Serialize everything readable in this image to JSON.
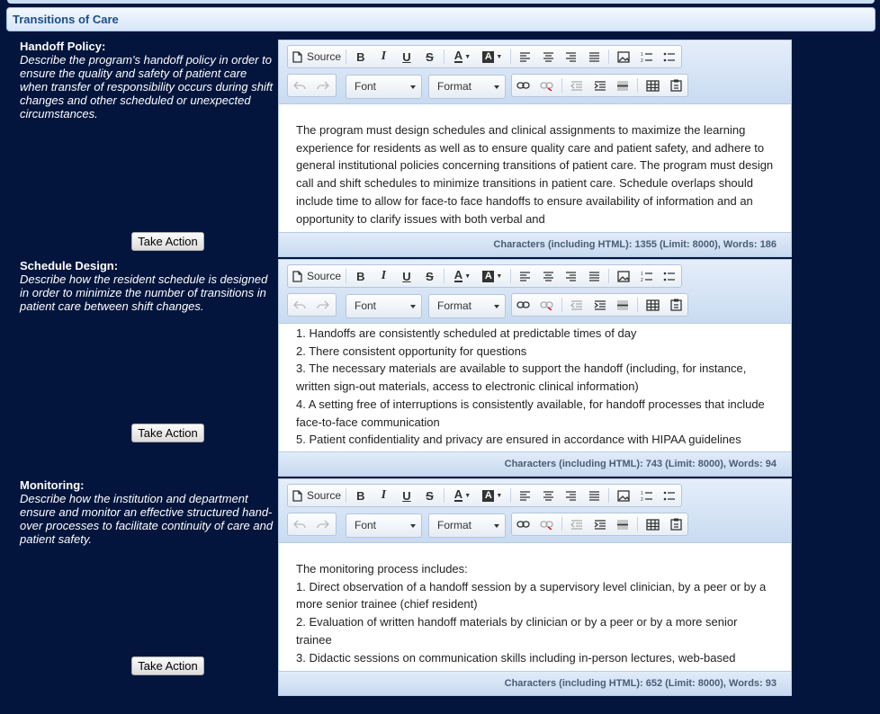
{
  "section_title": "Transitions of Care",
  "toolbar": {
    "source_label": "Source",
    "font_label": "Font",
    "format_label": "Format"
  },
  "take_action_label": "Take Action",
  "questions": [
    {
      "title": "Handoff Policy:",
      "description": "Describe the program's handoff policy in order to ensure the quality and safety of patient care when transfer of responsibility occurs during shift changes and other scheduled or unexpected circumstances.",
      "content": [
        "The program must design schedules and clinical assignments to maximize the learning experience for residents as well as to ensure quality care and patient safety, and adhere to general institutional policies concerning transitions of patient care. The program must design call and shift schedules to minimize transitions in patient care. Schedule overlaps should include time to allow for face-to face handoffs to ensure availability of information and an opportunity to clarify issues with both verbal and"
      ],
      "status": "Characters (including HTML): 1355 (Limit: 8000), Words: 186"
    },
    {
      "title": "Schedule Design:",
      "description": "Describe how the resident schedule is designed in order to minimize the number of transitions in patient care between shift changes.",
      "content": [
        "1. Handoffs are consistently scheduled at predictable times of day",
        "2. There consistent opportunity for questions",
        "3. The necessary materials are available to support the handoff (including, for instance, written sign-out materials, access to electronic clinical information)",
        "4. A setting free of interruptions is consistently available, for handoff processes that include face-to-face communication",
        "5. Patient confidentiality and privacy are ensured in accordance with HIPAA guidelines"
      ],
      "status": "Characters (including HTML): 743 (Limit: 8000), Words: 94"
    },
    {
      "title": "Monitoring:",
      "description": "Describe how the institution and department ensure and monitor an effective structured hand-over processes to facilitate continuity of care and patient safety.",
      "content": [
        "The monitoring process includes:",
        "1. Direct observation of a handoff session by a supervisory level clinician, by a peer or by a more senior trainee (chief resident)",
        "2. Evaluation of written handoff materials by clinician or by a peer or by a more senior trainee",
        "3. Didactic sessions on communication skills including in-person lectures, web-based"
      ],
      "status": "Characters (including HTML): 652 (Limit: 8000), Words: 93"
    }
  ]
}
